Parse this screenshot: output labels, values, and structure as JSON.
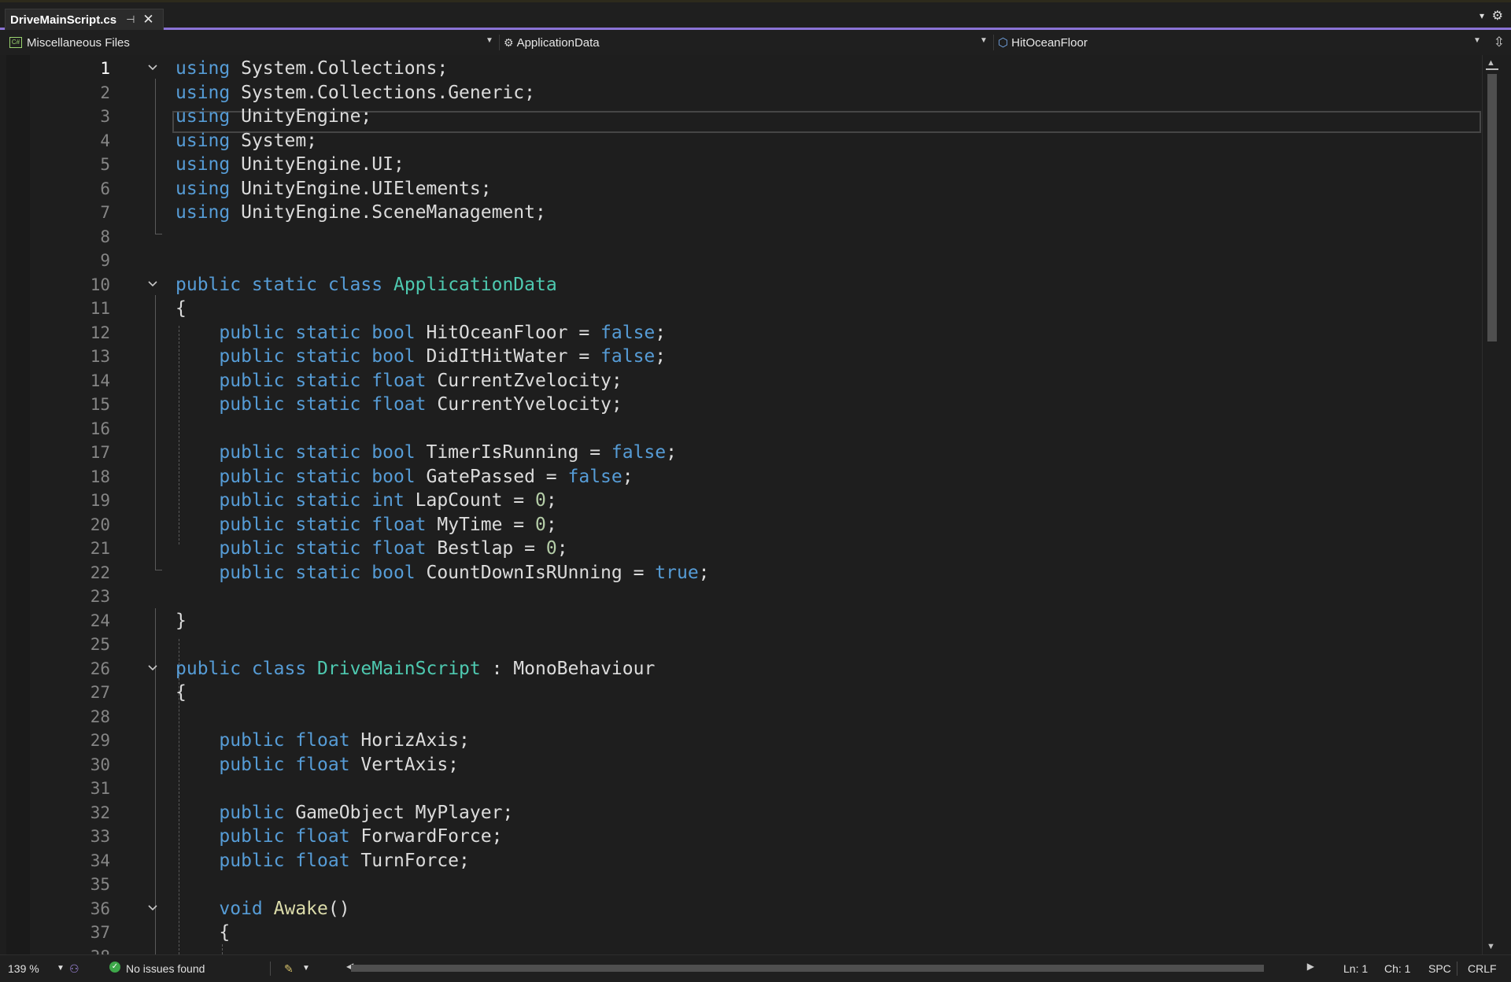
{
  "tab": {
    "title": "DriveMainScript.cs",
    "pin": "⊣",
    "close": "✕"
  },
  "navbar": {
    "project": "Miscellaneous Files",
    "type": "ApplicationData",
    "member": "HitOceanFloor"
  },
  "editor": {
    "current_line": 1,
    "lines": [
      [
        [
          "kw",
          "using"
        ],
        [
          "pl",
          " System.Collections;"
        ]
      ],
      [
        [
          "kw",
          "using"
        ],
        [
          "pl",
          " System.Collections.Generic;"
        ]
      ],
      [
        [
          "kw",
          "using"
        ],
        [
          "pl",
          " UnityEngine;"
        ]
      ],
      [
        [
          "kw",
          "using"
        ],
        [
          "pl",
          " System;"
        ]
      ],
      [
        [
          "kw",
          "using"
        ],
        [
          "pl",
          " UnityEngine.UI;"
        ]
      ],
      [
        [
          "kw",
          "using"
        ],
        [
          "pl",
          " UnityEngine.UIElements;"
        ]
      ],
      [
        [
          "kw",
          "using"
        ],
        [
          "pl",
          " UnityEngine.SceneManagement;"
        ]
      ],
      [],
      [],
      [
        [
          "kw",
          "public static class"
        ],
        [
          "pl",
          " "
        ],
        [
          "ty",
          "ApplicationData"
        ]
      ],
      [
        [
          "pl",
          "{"
        ]
      ],
      [
        [
          "pl",
          "    "
        ],
        [
          "kw",
          "public static bool"
        ],
        [
          "pl",
          " HitOceanFloor = "
        ],
        [
          "kw",
          "false"
        ],
        [
          "pl",
          ";"
        ]
      ],
      [
        [
          "pl",
          "    "
        ],
        [
          "kw",
          "public static bool"
        ],
        [
          "pl",
          " DidItHitWater = "
        ],
        [
          "kw",
          "false"
        ],
        [
          "pl",
          ";"
        ]
      ],
      [
        [
          "pl",
          "    "
        ],
        [
          "kw",
          "public static float"
        ],
        [
          "pl",
          " CurrentZvelocity;"
        ]
      ],
      [
        [
          "pl",
          "    "
        ],
        [
          "kw",
          "public static float"
        ],
        [
          "pl",
          " CurrentYvelocity;"
        ]
      ],
      [],
      [
        [
          "pl",
          "    "
        ],
        [
          "kw",
          "public static bool"
        ],
        [
          "pl",
          " TimerIsRunning = "
        ],
        [
          "kw",
          "false"
        ],
        [
          "pl",
          ";"
        ]
      ],
      [
        [
          "pl",
          "    "
        ],
        [
          "kw",
          "public static bool"
        ],
        [
          "pl",
          " GatePassed = "
        ],
        [
          "kw",
          "false"
        ],
        [
          "pl",
          ";"
        ]
      ],
      [
        [
          "pl",
          "    "
        ],
        [
          "kw",
          "public static int"
        ],
        [
          "pl",
          " LapCount = "
        ],
        [
          "nu",
          "0"
        ],
        [
          "pl",
          ";"
        ]
      ],
      [
        [
          "pl",
          "    "
        ],
        [
          "kw",
          "public static float"
        ],
        [
          "pl",
          " MyTime = "
        ],
        [
          "nu",
          "0"
        ],
        [
          "pl",
          ";"
        ]
      ],
      [
        [
          "pl",
          "    "
        ],
        [
          "kw",
          "public static float"
        ],
        [
          "pl",
          " Bestlap = "
        ],
        [
          "nu",
          "0"
        ],
        [
          "pl",
          ";"
        ]
      ],
      [
        [
          "pl",
          "    "
        ],
        [
          "kw",
          "public static bool"
        ],
        [
          "pl",
          " CountDownIsRUnning = "
        ],
        [
          "kw",
          "true"
        ],
        [
          "pl",
          ";"
        ]
      ],
      [],
      [
        [
          "pl",
          "}"
        ]
      ],
      [],
      [
        [
          "kw",
          "public class"
        ],
        [
          "pl",
          " "
        ],
        [
          "ty",
          "DriveMainScript"
        ],
        [
          "pl",
          " : MonoBehaviour"
        ]
      ],
      [
        [
          "pl",
          "{"
        ]
      ],
      [],
      [
        [
          "pl",
          "    "
        ],
        [
          "kw",
          "public float"
        ],
        [
          "pl",
          " HorizAxis;"
        ]
      ],
      [
        [
          "pl",
          "    "
        ],
        [
          "kw",
          "public float"
        ],
        [
          "pl",
          " VertAxis;"
        ]
      ],
      [],
      [
        [
          "pl",
          "    "
        ],
        [
          "kw",
          "public"
        ],
        [
          "pl",
          " GameObject MyPlayer;"
        ]
      ],
      [
        [
          "pl",
          "    "
        ],
        [
          "kw",
          "public float"
        ],
        [
          "pl",
          " ForwardForce;"
        ]
      ],
      [
        [
          "pl",
          "    "
        ],
        [
          "kw",
          "public float"
        ],
        [
          "pl",
          " TurnForce;"
        ]
      ],
      [],
      [
        [
          "pl",
          "    "
        ],
        [
          "kw",
          "void"
        ],
        [
          "pl",
          " "
        ],
        [
          "fn",
          "Awake"
        ],
        [
          "pl",
          "()"
        ]
      ],
      [
        [
          "pl",
          "    {"
        ]
      ],
      []
    ],
    "fold_lines": [
      1,
      10,
      26,
      36
    ]
  },
  "statusbar": {
    "zoom": "139 %",
    "issues": "No issues found",
    "line": "Ln: 1",
    "char": "Ch: 1",
    "indent": "SPC",
    "eol": "CRLF"
  },
  "icons": {
    "tab_menu": "chevron-down-icon",
    "settings": "gear-icon",
    "split": "split-editor-icon",
    "ok": "check-circle-icon",
    "cleanup": "brush-icon"
  }
}
